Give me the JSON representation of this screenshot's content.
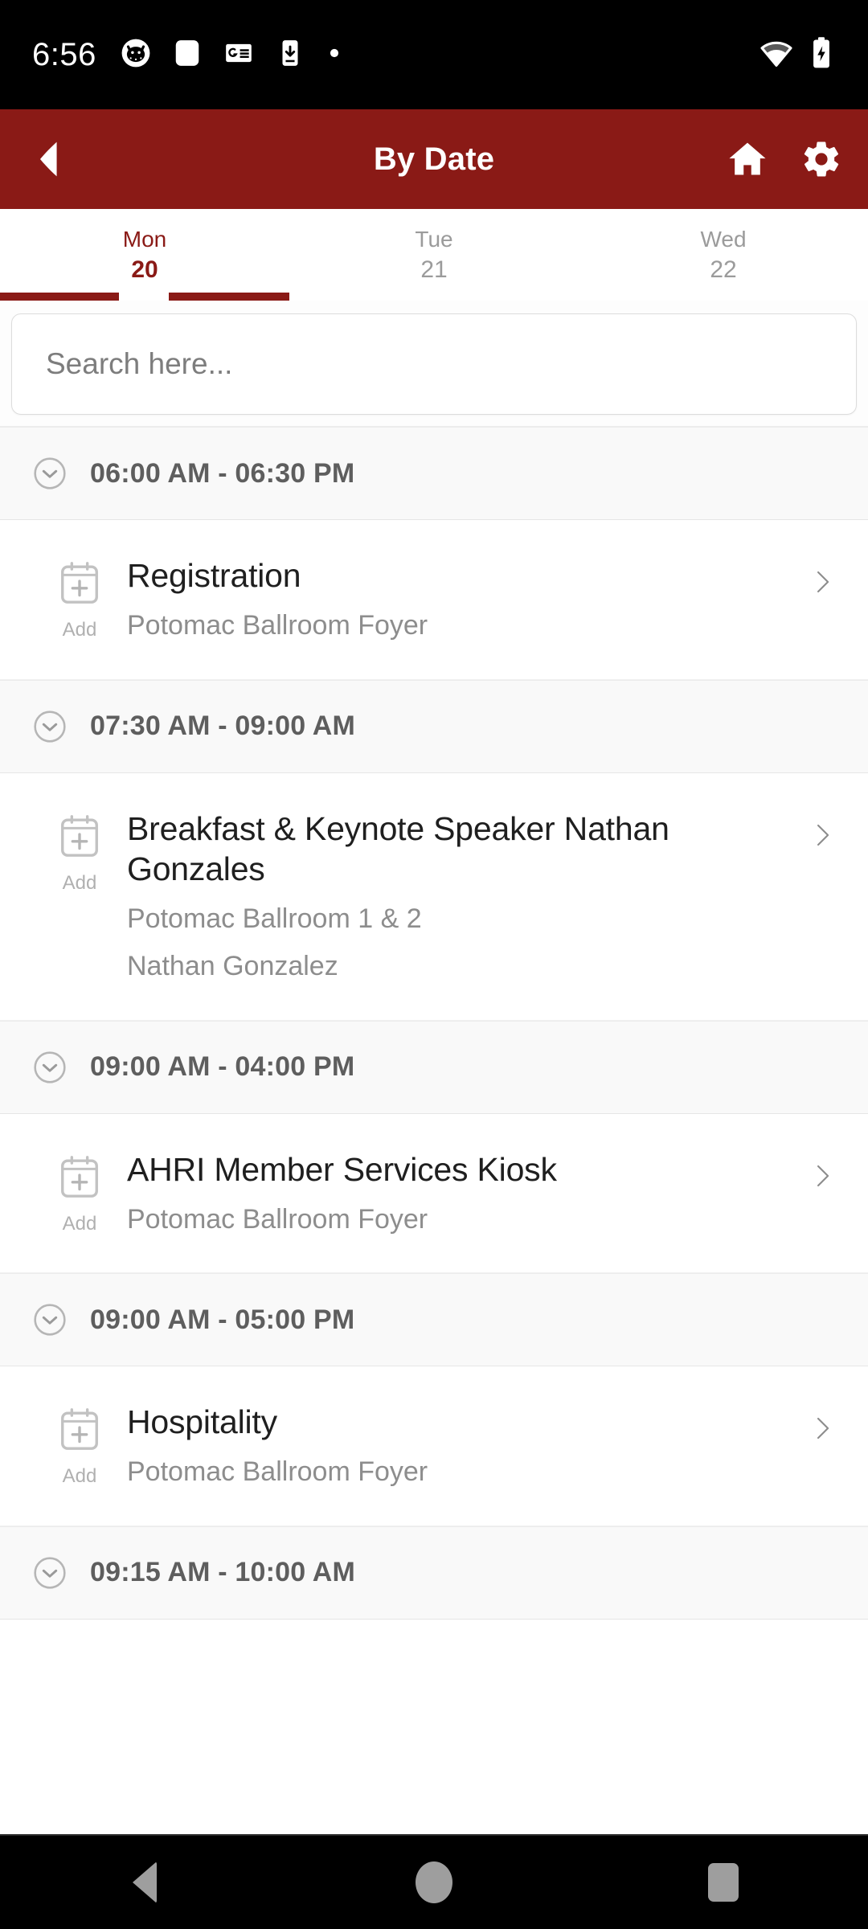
{
  "status_bar": {
    "time": "6:56",
    "left_icons": [
      "cat-face-icon",
      "rounded-square-icon",
      "google-news-icon",
      "app-download-icon",
      "dot-icon"
    ],
    "right_icons": [
      "wifi-icon",
      "battery-charging-icon"
    ]
  },
  "header": {
    "title": "By Date",
    "back_icon": "back-arrow-icon",
    "home_icon": "home-icon",
    "settings_icon": "gear-icon",
    "background_color": "#8a1a16"
  },
  "date_tabs": [
    {
      "day": "Mon",
      "date": "20",
      "active": true
    },
    {
      "day": "Tue",
      "date": "21",
      "active": false
    },
    {
      "day": "Wed",
      "date": "22",
      "active": false
    }
  ],
  "search": {
    "placeholder": "Search here...",
    "value": ""
  },
  "agenda": [
    {
      "time": "06:00 AM - 06:30 PM",
      "sessions": [
        {
          "title": "Registration",
          "location": "Potomac Ballroom Foyer",
          "speaker": "",
          "add_label": "Add"
        }
      ]
    },
    {
      "time": "07:30 AM - 09:00 AM",
      "sessions": [
        {
          "title": "Breakfast & Keynote Speaker Nathan Gonzales",
          "location": "Potomac Ballroom 1 & 2",
          "speaker": "Nathan Gonzalez",
          "add_label": "Add"
        }
      ]
    },
    {
      "time": "09:00 AM - 04:00 PM",
      "sessions": [
        {
          "title": "AHRI Member Services Kiosk",
          "location": "Potomac Ballroom Foyer",
          "speaker": "",
          "add_label": "Add"
        }
      ]
    },
    {
      "time": "09:00 AM - 05:00 PM",
      "sessions": [
        {
          "title": "Hospitality",
          "location": "Potomac Ballroom Foyer",
          "speaker": "",
          "add_label": "Add"
        }
      ]
    },
    {
      "time": "09:15 AM - 10:00 AM",
      "sessions": []
    }
  ],
  "nav_bar": {
    "back": "nav-back-icon",
    "home": "nav-home-icon",
    "recents": "nav-recents-icon"
  },
  "colors": {
    "brand_red": "#8a1a16",
    "time_header_bg": "#f9f9f9",
    "muted_text": "#8d8d8d"
  }
}
